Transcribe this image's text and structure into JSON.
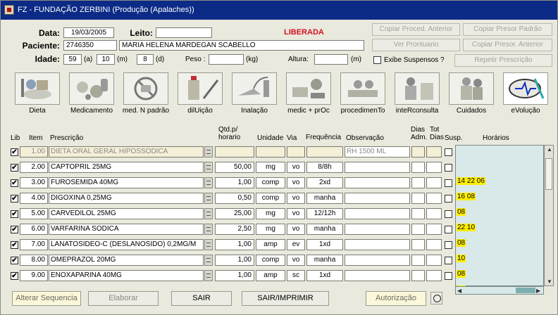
{
  "window": {
    "title": "FZ - FUNDAÇÃO ZERBINI (Produção (Apalaches))"
  },
  "patient": {
    "data_label": "Data:",
    "data_value": "19/03/2005",
    "leito_label": "Leito:",
    "leito_value": "",
    "paciente_label": "Paciente:",
    "paciente_id": "2746350",
    "paciente_name": "MARIA HELENA MARDEGAN SCABELLO",
    "idade_label": "Idade:",
    "idade_a": "59",
    "idade_a_unit": "(a)",
    "idade_m": "10",
    "idade_m_unit": "(m)",
    "idade_d": "8",
    "idade_d_unit": "(d)",
    "peso_label": "Peso :",
    "peso_value": "",
    "peso_unit": "(kg)",
    "altura_label": "Altura:",
    "altura_value": "",
    "altura_unit": "(m)",
    "status": "LIBERADA",
    "status_color": "#d4101f"
  },
  "actions": {
    "copiar_proced": "Copiar Proced. Anterior",
    "copiar_presor_padrao": "Copiar Presor Padrão",
    "ver_prontuario": "Ver Prontuario",
    "copiar_presor_anterior": "Copiar Presor. Anterior",
    "exibe_suspensos": "Exibe Suspensos ?",
    "repetir_prescricao": "Repetir Prescrição"
  },
  "toolbar": [
    {
      "label": "Dieta",
      "icon": "dieta-icon"
    },
    {
      "label": "Medicamento",
      "icon": "medicamento-icon"
    },
    {
      "label": "med. N padrão",
      "icon": "med-n-padrao-icon"
    },
    {
      "label": "dilUição",
      "icon": "diluicao-icon"
    },
    {
      "label": "Inalação",
      "icon": "inalacao-icon"
    },
    {
      "label": "medic + prOc",
      "icon": "medic-proc-icon"
    },
    {
      "label": "procedimenTo",
      "icon": "procedimento-icon"
    },
    {
      "label": "inteRconsulta",
      "icon": "interconsulta-icon"
    },
    {
      "label": "Cuidados",
      "icon": "cuidados-icon"
    },
    {
      "label": "eVolução",
      "icon": "evolucao-icon"
    }
  ],
  "table": {
    "headers": {
      "lib": "Lib",
      "item": "Item",
      "prescricao": "Prescrição",
      "qtd": "Qtd.p/\nhorario",
      "unidade": "Unidade",
      "via": "Via",
      "frequencia": "Frequência",
      "observacao": "Observação",
      "dias_adm": "Dias\nAdm.",
      "tot_dias": "Tot\nDias",
      "susp": "Susp.",
      "horarios": "Horários"
    },
    "rows": [
      {
        "checked": true,
        "item": "1.00",
        "prescricao": "DIETA ORAL GERAL HIPOSSODICA",
        "qtd": "",
        "unidade": "",
        "via": "",
        "frequencia": "",
        "observacao": "RH 1500 ML",
        "horarios": ""
      },
      {
        "checked": true,
        "item": "2.00",
        "prescricao": "CAPTOPRIL 25MG",
        "qtd": "50,00",
        "unidade": "mg",
        "via": "vo",
        "frequencia": "8/8h",
        "observacao": "",
        "horarios": "14 22 06"
      },
      {
        "checked": true,
        "item": "3.00",
        "prescricao": "FUROSEMIDA 40MG",
        "qtd": "1,00",
        "unidade": "comp",
        "via": "vo",
        "frequencia": "2xd",
        "observacao": "",
        "horarios": "16 08"
      },
      {
        "checked": true,
        "item": "4.00",
        "prescricao": "DIGOXINA 0,25MG",
        "qtd": "0,50",
        "unidade": "comp",
        "via": "vo",
        "frequencia": "manha",
        "observacao": "",
        "horarios": "08"
      },
      {
        "checked": true,
        "item": "5.00",
        "prescricao": "CARVEDILOL 25MG",
        "qtd": "25,00",
        "unidade": "mg",
        "via": "vo",
        "frequencia": "12/12h",
        "observacao": "",
        "horarios": "22 10"
      },
      {
        "checked": true,
        "item": "6.00",
        "prescricao": "VARFARINA SODICA",
        "qtd": "2,50",
        "unidade": "mg",
        "via": "vo",
        "frequencia": "manha",
        "observacao": "",
        "horarios": "08"
      },
      {
        "checked": true,
        "item": "7.00",
        "prescricao": "LANATOSIDEO-C (DESLANOSIDO) 0,2MG/M",
        "qtd": "1,00",
        "unidade": "amp",
        "via": "ev",
        "frequencia": "1xd",
        "observacao": "",
        "horarios": "10"
      },
      {
        "checked": true,
        "item": "8.00",
        "prescricao": "OMEPRAZOL 20MG",
        "qtd": "1,00",
        "unidade": "comp",
        "via": "vo",
        "frequencia": "manha",
        "observacao": "",
        "horarios": "08"
      },
      {
        "checked": true,
        "item": "9.00",
        "prescricao": "ENOXAPARINA 40MG",
        "qtd": "1,00",
        "unidade": "amp",
        "via": "sc",
        "frequencia": "1xd",
        "observacao": "",
        "horarios": "10"
      }
    ]
  },
  "bottom": {
    "alterar_sequencia": "Alterar Sequencia",
    "elaborar": "Elaborar",
    "sair": "SAIR",
    "sair_imprimir": "SAIR/IMPRIMIR",
    "autorizacao": "Autorização"
  },
  "colors": {
    "title_bar": "#0c2b86",
    "highlight": "#ffee00",
    "panel": "#d9e8e8"
  }
}
